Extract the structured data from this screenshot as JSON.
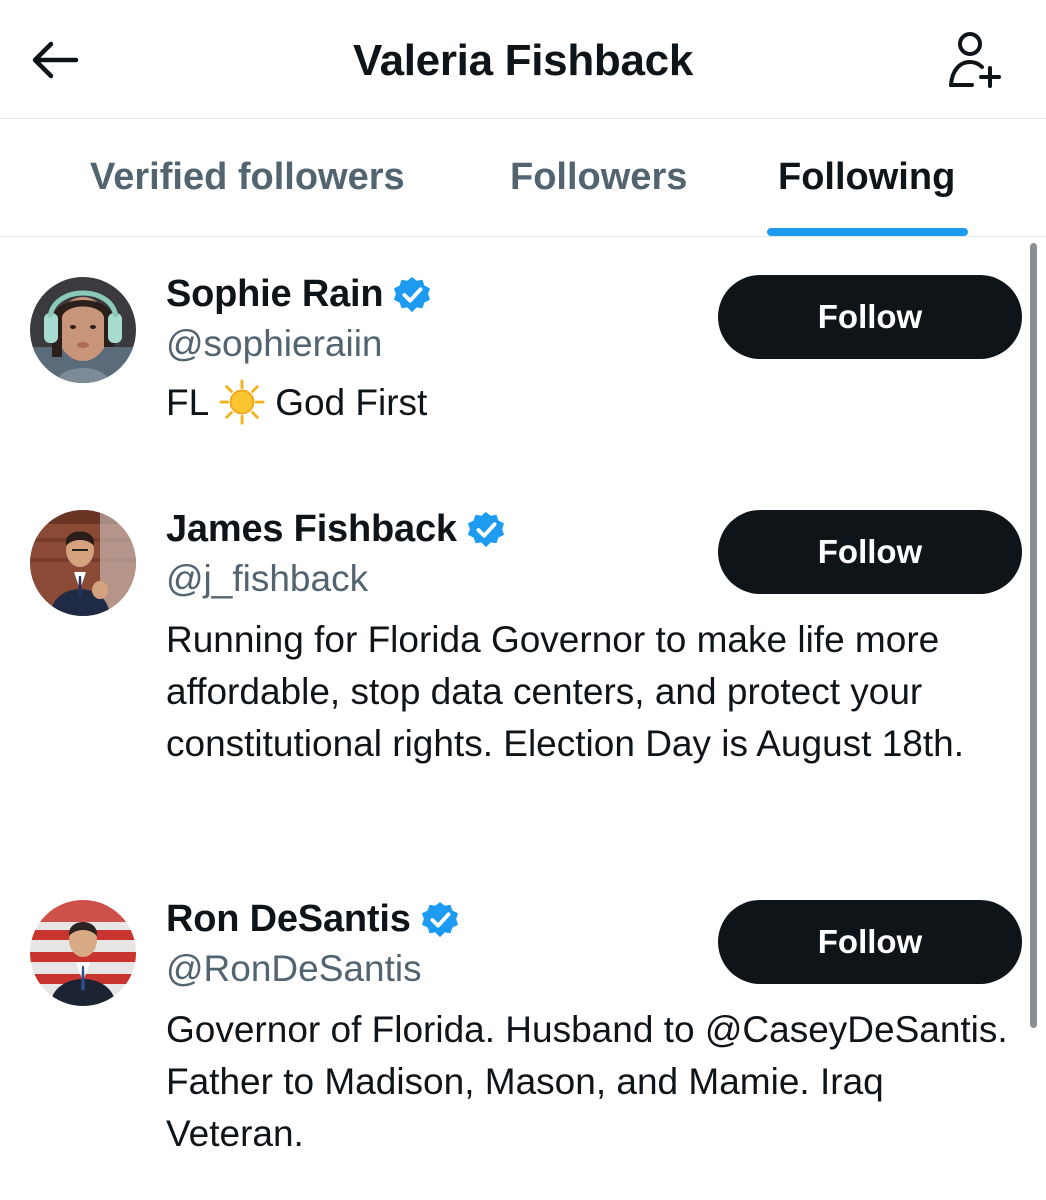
{
  "header": {
    "title": "Valeria Fishback",
    "back_icon": "arrow-left-icon",
    "add_user_icon": "person-plus-icon"
  },
  "tabs": [
    {
      "label": "Verified followers",
      "active": false
    },
    {
      "label": "Followers",
      "active": false
    },
    {
      "label": "Following",
      "active": true
    }
  ],
  "colors": {
    "accent": "#1d9bf0",
    "text_primary": "#0f1419",
    "text_secondary": "#536471",
    "button_bg": "#0f1419"
  },
  "users": [
    {
      "name": "Sophie Rain",
      "handle": "@sophieraiin",
      "verified": true,
      "bio_before_emoji": "FL",
      "bio_emoji": "sun-emoji",
      "bio_after_emoji": "God First",
      "button_label": "Follow"
    },
    {
      "name": "James Fishback",
      "handle": "@j_fishback",
      "verified": true,
      "bio": "Running for Florida Governor to make life more affordable, stop data centers, and protect your constitutional rights. Election Day is August 18th.",
      "button_label": "Follow"
    },
    {
      "name": "Ron DeSantis",
      "handle": "@RonDeSantis",
      "verified": true,
      "bio": "Governor of Florida. Husband to @CaseyDeSantis. Father to Madison, Mason, and Mamie. Iraq Veteran.",
      "button_label": "Follow"
    }
  ]
}
